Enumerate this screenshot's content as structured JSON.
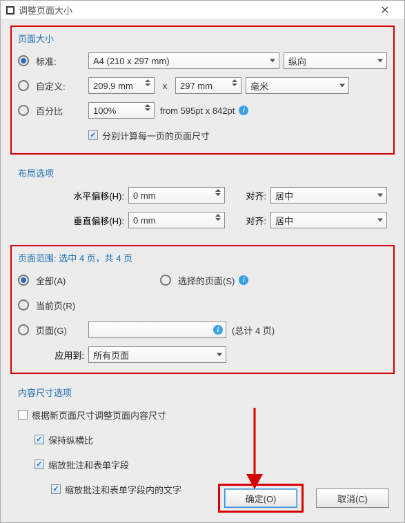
{
  "window": {
    "title": "调整页面大小"
  },
  "pageSize": {
    "title": "页面大小",
    "standard_label": "标准:",
    "standard_preset": "A4 (210 x 297 mm)",
    "orientation": "纵向",
    "custom_label": "自定义:",
    "custom_w": "209.9 mm",
    "custom_x": "x",
    "custom_h": "297 mm",
    "custom_unit": "毫米",
    "percent_label": "百分比",
    "percent_val": "100%",
    "from_text": "from 595pt x 842pt",
    "calc_each": "分别计算每一页的页面尺寸"
  },
  "layout": {
    "title": "布局选项",
    "hoff_label": "水平偏移(H):",
    "hoff_val": "0 mm",
    "align_label": "对齐:",
    "align_h": "居中",
    "voff_label": "垂直偏移(H):",
    "voff_val": "0 mm",
    "align_v": "居中"
  },
  "range": {
    "title": "页面范围: 选中 4 页，共 4 页",
    "all_label": "全部(A)",
    "selected_label": "选择的页面(S)",
    "current_label": "当前页(R)",
    "pages_label": "页面(G)",
    "total_text": "(总计 4 页)",
    "apply_label": "应用到:",
    "apply_val": "所有页面"
  },
  "contentOpts": {
    "title": "内容尺寸选项",
    "resize_content": "根据新页面尺寸调整页面内容尺寸",
    "keep_ratio": "保持纵横比",
    "scale_annot": "缩放批注和表单字段",
    "scale_text": "缩放批注和表单字段内的文字"
  },
  "buttons": {
    "ok": "确定(O)",
    "cancel": "取消(C)"
  }
}
